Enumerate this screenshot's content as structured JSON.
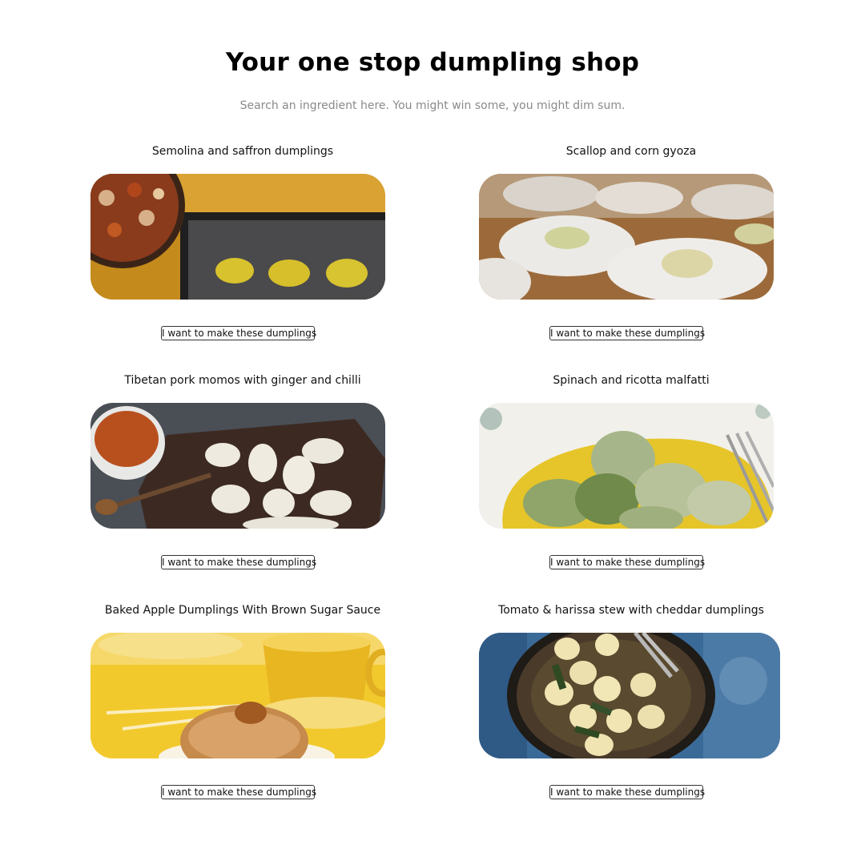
{
  "header": {
    "title": "Your one stop dumpling shop",
    "subtitle": "Search an ingredient here. You might win some, you might dim sum."
  },
  "recipes": [
    {
      "title": "Semolina and saffron dumplings",
      "button_label": "I want to make these dumplings",
      "image": "semolina-dumplings-photo"
    },
    {
      "title": "Scallop and corn gyoza",
      "button_label": "I want to make these dumplings",
      "image": "scallop-gyoza-photo"
    },
    {
      "title": "Tibetan pork momos with ginger and chilli",
      "button_label": "I want to make these dumplings",
      "image": "pork-momos-photo"
    },
    {
      "title": "Spinach and ricotta malfatti",
      "button_label": "I want to make these dumplings",
      "image": "malfatti-photo"
    },
    {
      "title": "Baked Apple Dumplings With Brown Sugar Sauce",
      "button_label": "I want to make these dumplings",
      "image": "apple-dumplings-photo"
    },
    {
      "title": "Tomato & harissa stew with cheddar dumplings",
      "button_label": "I want to make these dumplings",
      "image": "harissa-stew-photo"
    }
  ]
}
